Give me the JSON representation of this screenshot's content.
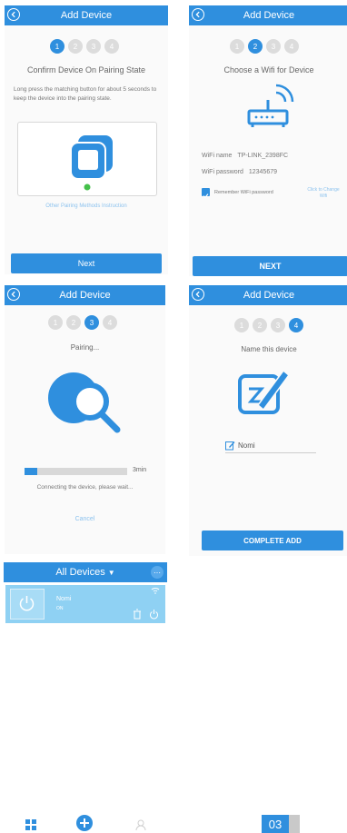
{
  "screen1": {
    "header_title": "Add Device",
    "steps": [
      "1",
      "2",
      "3",
      "4"
    ],
    "active_step": 1,
    "title": "Confirm Device On Pairing State",
    "instructions": "Long press the matching button for about 5 seconds to keep the device into the pairing state.",
    "other_methods_link": "Other Pairing Methods Instruction",
    "next_button": "Next"
  },
  "screen2": {
    "header_title": "Add Device",
    "steps": [
      "1",
      "2",
      "3",
      "4"
    ],
    "active_step": 2,
    "title": "Choose a Wifi for Device",
    "wifi_name_label": "WiFi name",
    "wifi_name_value": "TP-LINK_2398FC",
    "wifi_password_label": "WiFi password",
    "wifi_password_value": "12345679",
    "remember_label": "Remember WiFi password",
    "remember_checked": true,
    "change_link": "Click to Change Wifi",
    "next_button": "NEXT"
  },
  "screen3": {
    "header_title": "Add Device",
    "steps": [
      "1",
      "2",
      "3",
      "4"
    ],
    "active_step": 3,
    "status": "Pairing...",
    "progress_fraction": 0.12,
    "time_label": "3min",
    "message": "Connecting the device, please wait...",
    "cancel_link": "Cancel"
  },
  "screen4": {
    "header_title": "Add Device",
    "steps": [
      "1",
      "2",
      "3",
      "4"
    ],
    "active_step": 4,
    "title": "Name this device",
    "name_value": "Nomi",
    "complete_button": "COMPLETE ADD"
  },
  "screen5": {
    "header_title": "All Devices",
    "device_name": "Nomi",
    "device_status": "ON"
  },
  "page_number": "03",
  "colors": {
    "accent": "#2f8fde",
    "device_card": "#8fd1f3",
    "disabled_step": "#dcdcdc"
  },
  "icons": [
    "back-arrow-icon",
    "wifi-router-icon",
    "device-pairing-icon",
    "search-magnifier-icon",
    "edit-pen-icon",
    "power-icon",
    "trash-icon",
    "grid-icon",
    "add-icon",
    "user-icon"
  ]
}
